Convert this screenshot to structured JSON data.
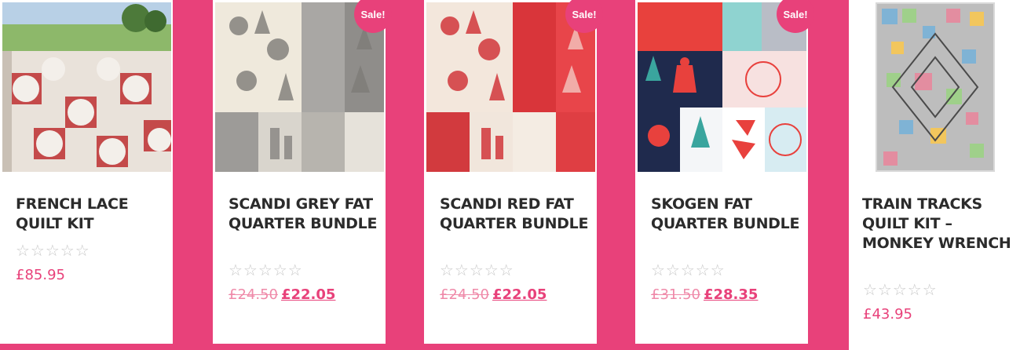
{
  "colors": {
    "brand": "#e8417a",
    "text": "#2b2b2b",
    "stars": "#c8c8c8"
  },
  "products": [
    {
      "title": "FRENCH LACE QUILT KIT",
      "rating_stars": "☆☆☆☆☆",
      "rating": 0,
      "price": "£85.95",
      "sale": false
    },
    {
      "title": "SCANDI GREY FAT QUARTER BUNDLE",
      "rating_stars": "☆☆☆☆☆",
      "rating": 0,
      "old_price": "£24.50",
      "price": "£22.05",
      "sale": true,
      "badge": "Sale!"
    },
    {
      "title": "SCANDI RED FAT QUARTER BUNDLE",
      "rating_stars": "☆☆☆☆☆",
      "rating": 0,
      "old_price": "£24.50",
      "price": "£22.05",
      "sale": true,
      "badge": "Sale!"
    },
    {
      "title": "SKOGEN FAT QUARTER BUNDLE",
      "rating_stars": "☆☆☆☆☆",
      "rating": 0,
      "old_price": "£31.50",
      "price": "£28.35",
      "sale": true,
      "badge": "Sale!"
    },
    {
      "title": "TRAIN TRACKS QUILT KIT – MONKEY WRENCH",
      "rating_stars": "☆☆☆☆☆",
      "rating": 0,
      "price": "£43.95",
      "sale": false
    }
  ]
}
